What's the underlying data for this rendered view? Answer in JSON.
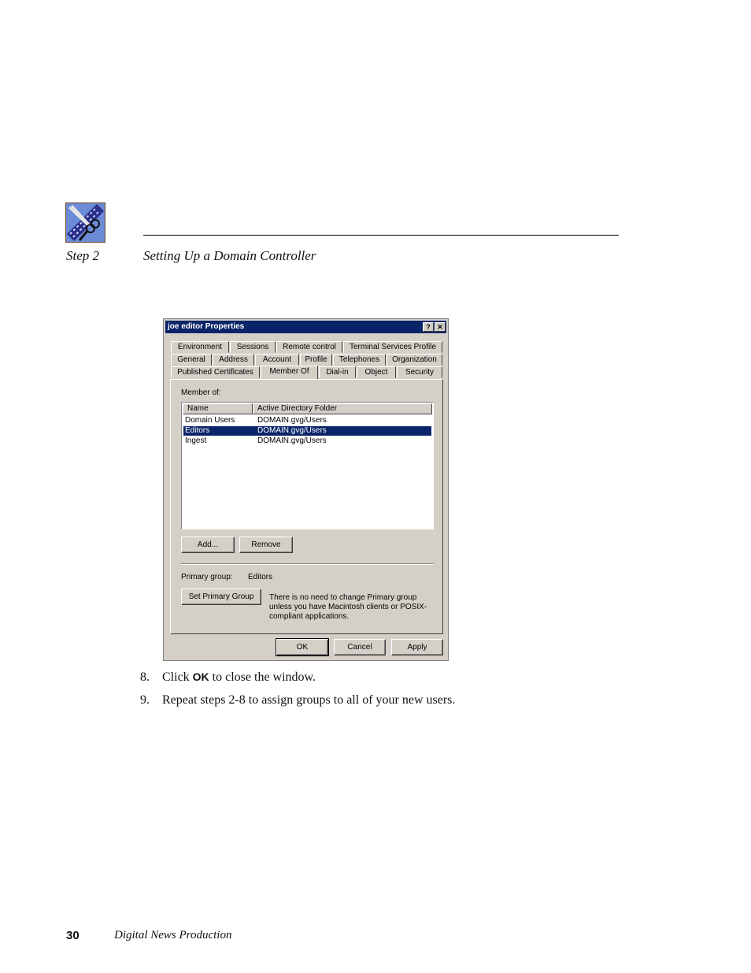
{
  "header": {
    "step_label": "Step 2",
    "section_title": "Setting Up a Domain Controller"
  },
  "dialog": {
    "title": "joe editor Properties",
    "help_btn": "?",
    "close_btn": "✕",
    "tabs_row1": [
      "Environment",
      "Sessions",
      "Remote control",
      "Terminal Services Profile"
    ],
    "tabs_row2": [
      "General",
      "Address",
      "Account",
      "Profile",
      "Telephones",
      "Organization"
    ],
    "tabs_row3": [
      "Published Certificates",
      "Member Of",
      "Dial-in",
      "Object",
      "Security"
    ],
    "member_of_label": "Member of:",
    "columns": [
      "Name",
      "Active Directory Folder"
    ],
    "rows": [
      {
        "name": "Domain Users",
        "folder": "DOMAIN.gvg/Users"
      },
      {
        "name": "Editors",
        "folder": "DOMAIN.gvg/Users"
      },
      {
        "name": "Ingest",
        "folder": "DOMAIN.gvg/Users"
      }
    ],
    "add_btn": "Add...",
    "remove_btn": "Remove",
    "primary_group_label": "Primary group:",
    "primary_group_value": "Editors",
    "set_primary_btn": "Set Primary Group",
    "note": "There is no need to change Primary group unless you have Macintosh clients or POSIX-compliant applications.",
    "ok_btn": "OK",
    "cancel_btn": "Cancel",
    "apply_btn": "Apply"
  },
  "steps": [
    {
      "number": "8.",
      "pre": "Click ",
      "bold": "OK",
      "post": " to close the window."
    },
    {
      "number": "9.",
      "text": "Repeat steps 2-8 to assign groups to all of your new users."
    }
  ],
  "footer": {
    "page_number": "30",
    "book_title": "Digital News Production"
  }
}
